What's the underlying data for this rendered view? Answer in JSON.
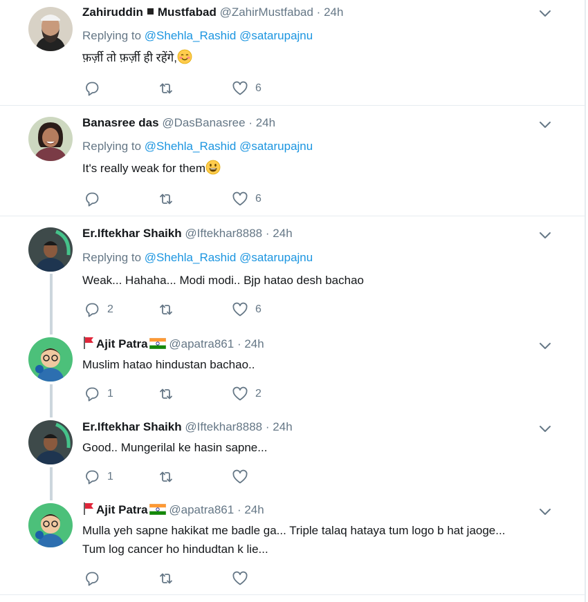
{
  "tweets": [
    {
      "name": "Zahiruddin",
      "name_suffix": "Mustfabad",
      "handle": "@ZahirMustfabad",
      "time": "24h",
      "replying_prefix": "Replying to",
      "replying_to": [
        "@Shehla_Rashid",
        "@satarupajnu"
      ],
      "text": "फ़र्ज़ी तो फ़र्ज़ी ही रहेंगे,",
      "replies": "",
      "retweets": "",
      "likes": "6"
    },
    {
      "name": "Banasree das",
      "handle": "@DasBanasree",
      "time": "24h",
      "replying_prefix": "Replying to",
      "replying_to": [
        "@Shehla_Rashid",
        "@satarupajnu"
      ],
      "text": "It's really weak for them",
      "replies": "",
      "retweets": "",
      "likes": "6"
    },
    {
      "name": "Er.Iftekhar Shaikh",
      "handle": "@Iftekhar8888",
      "time": "24h",
      "replying_prefix": "Replying to",
      "replying_to": [
        "@Shehla_Rashid",
        "@satarupajnu"
      ],
      "text": "Weak... Hahaha... Modi modi.. Bjp hatao desh bachao",
      "replies": "2",
      "retweets": "",
      "likes": "6"
    },
    {
      "name": "Ajit Patra",
      "handle": "@apatra861",
      "time": "24h",
      "text": "Muslim hatao hindustan bachao..",
      "replies": "1",
      "retweets": "",
      "likes": "2"
    },
    {
      "name": "Er.Iftekhar Shaikh",
      "handle": "@Iftekhar8888",
      "time": "24h",
      "text": "Good.. Mungerilal ke hasin sapne...",
      "replies": "1",
      "retweets": "",
      "likes": ""
    },
    {
      "name": "Ajit Patra",
      "handle": "@apatra861",
      "time": "24h",
      "text_line1": "Mulla yeh sapne hakikat me badle ga... Triple talaq hataya tum logo b hat jaoge...",
      "text_line2": "Tum log cancer ho hindudtan k lie...",
      "replies": "",
      "retweets": "",
      "likes": ""
    }
  ],
  "separator": "·",
  "colors": {
    "text": "#14171a",
    "secondary": "#657786",
    "link": "#1b95e0",
    "divider": "#e6ecf0",
    "thread_line": "#ccd6dd"
  },
  "icons": [
    "reply-icon",
    "retweet-icon",
    "like-icon",
    "caret-down-icon",
    "india-flag-icon",
    "red-flag-icon",
    "smiling-face-icon",
    "grinning-face-icon"
  ]
}
